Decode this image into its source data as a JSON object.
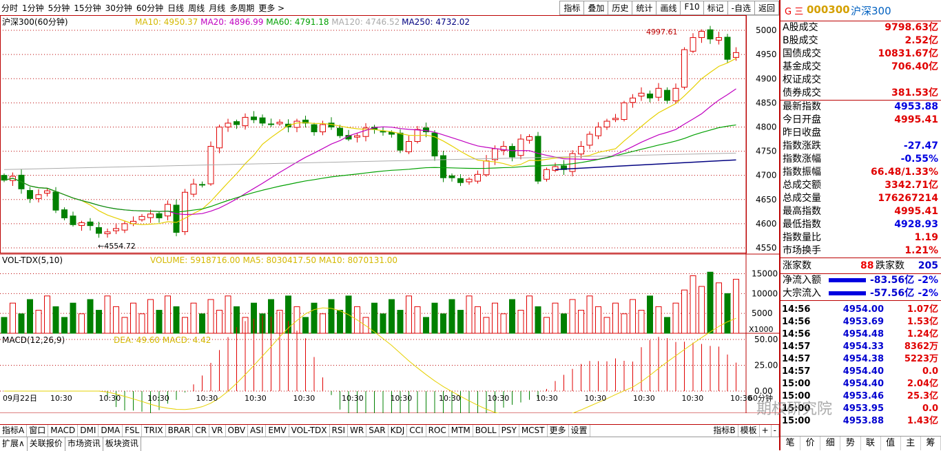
{
  "toolbar": {
    "periods": [
      "分时",
      "1分钟",
      "5分钟",
      "15分钟",
      "30分钟",
      "60分钟",
      "日线",
      "周线",
      "月线",
      "多周期",
      "更多 >"
    ],
    "tools": [
      "指标",
      "叠加",
      "历史",
      "统计",
      "画线",
      "F10",
      "标记",
      "-自选",
      "返回"
    ]
  },
  "main_chart": {
    "title": "沪深300(60分钟)",
    "ma_labels": [
      {
        "text": "MA10: 4950.37",
        "color": "#d4b800"
      },
      {
        "text": "MA20: 4896.99",
        "color": "#c000c0"
      },
      {
        "text": "MA60: 4791.18",
        "color": "#00a000"
      },
      {
        "text": "MA120: 4746.52",
        "color": "#aaaaaa"
      },
      {
        "text": "MA250: 4732.02",
        "color": "#000080"
      }
    ],
    "high_label": "4997.61",
    "low_label": "4554.72",
    "y_ticks": [
      "5000",
      "4950",
      "4900",
      "4850",
      "4800",
      "4750",
      "4700",
      "4650",
      "4600",
      "4550"
    ]
  },
  "volume_chart": {
    "title": "VOL-TDX(5,10)",
    "labels": "VOLUME: 5918716.00  MA5: 8030417.50  MA10: 8070131.00",
    "y_ticks": [
      "15000",
      "10000",
      "5000"
    ],
    "unit": "X1000"
  },
  "macd_chart": {
    "title": "MACD(12,26,9)",
    "labels": "DEA: 49.60  MACD: 4.42",
    "y_ticks": [
      "50.00",
      "25.00",
      "0.00"
    ]
  },
  "x_axis": {
    "first": "09月22日",
    "tick": "10:30",
    "period_label": "60分钟"
  },
  "indicator_tabs": [
    "指标A",
    "窗口",
    "MACD",
    "DMI",
    "DMA",
    "FSL",
    "TRIX",
    "BRAR",
    "CR",
    "VR",
    "OBV",
    "ASI",
    "EMV",
    "VOL-TDX",
    "RSI",
    "WR",
    "SAR",
    "KDJ",
    "CCI",
    "ROC",
    "MTM",
    "BOLL",
    "PSY",
    "MCST",
    "更多",
    "设置"
  ],
  "indicator_right": [
    "指标B",
    "模板",
    "+",
    "-"
  ],
  "bottom_tabs": [
    "扩展∧",
    "关联报价",
    "市场资讯",
    "板块资讯"
  ],
  "quote": {
    "flag": "G 三",
    "code": "000300",
    "name": "沪深300",
    "rows": [
      {
        "label": "A股成交",
        "value": "9798.63亿",
        "color": "red"
      },
      {
        "label": "B股成交",
        "value": "2.52亿",
        "color": "red"
      },
      {
        "label": "国债成交",
        "value": "10831.67亿",
        "color": "red"
      },
      {
        "label": "基金成交",
        "value": "706.40亿",
        "color": "red"
      },
      {
        "label": "权证成交",
        "value": "",
        "color": "red"
      },
      {
        "label": "债券成交",
        "value": "381.53亿",
        "color": "red"
      },
      {
        "label": "最新指数",
        "value": "4953.88",
        "color": "blue"
      },
      {
        "label": "今日开盘",
        "value": "4995.41",
        "color": "red"
      },
      {
        "label": "昨日收盘",
        "value": "",
        "color": "red"
      },
      {
        "label": "指数涨跌",
        "value": "-27.47",
        "color": "blue"
      },
      {
        "label": "指数涨幅",
        "value": "-0.55%",
        "color": "blue"
      },
      {
        "label": "指数振幅",
        "value": "66.48/1.33%",
        "color": "red"
      },
      {
        "label": "总成交额",
        "value": "3342.71亿",
        "color": "red"
      },
      {
        "label": "总成交量",
        "value": "176267214",
        "color": "red"
      },
      {
        "label": "最高指数",
        "value": "4995.41",
        "color": "red"
      },
      {
        "label": "最低指数",
        "value": "4928.93",
        "color": "blue"
      },
      {
        "label": "指数量比",
        "value": "1.19",
        "color": "red"
      },
      {
        "label": "市场换手",
        "value": "1.21%",
        "color": "red"
      }
    ],
    "updown": {
      "up_label": "涨家数",
      "up": "88",
      "down_label": "跌家数",
      "down": "205"
    },
    "flows": [
      {
        "label": "净流入额",
        "value": "-83.56亿",
        "pct": "-2%"
      },
      {
        "label": "大宗流入",
        "value": "-57.56亿",
        "pct": "-2%"
      }
    ],
    "ticks": [
      {
        "time": "14:56",
        "price": "4954.00",
        "vol": "1.07亿"
      },
      {
        "time": "14:56",
        "price": "4953.69",
        "vol": "1.53亿"
      },
      {
        "time": "14:56",
        "price": "4954.48",
        "vol": "1.24亿"
      },
      {
        "time": "14:57",
        "price": "4954.33",
        "vol": "8362万"
      },
      {
        "time": "14:57",
        "price": "4954.38",
        "vol": "5223万"
      },
      {
        "time": "14:57",
        "price": "4954.40",
        "vol": "0.0"
      },
      {
        "time": "15:00",
        "price": "4954.40",
        "vol": "2.04亿"
      },
      {
        "time": "15:00",
        "price": "4953.46",
        "vol": "25.3亿"
      },
      {
        "time": "15:00",
        "price": "4953.95",
        "vol": "0.0"
      },
      {
        "time": "15:00",
        "price": "4953.88",
        "vol": "1.43亿"
      }
    ],
    "tabs": [
      "笔",
      "价",
      "细",
      "势",
      "联",
      "值",
      "主",
      "筹"
    ]
  },
  "watermark": "期权研究院",
  "chart_data": {
    "type": "candlestick",
    "title": "沪深300(60分钟)",
    "ylim": [
      4540,
      5020
    ],
    "ma_series": [
      {
        "name": "MA10",
        "last": 4950.37
      },
      {
        "name": "MA20",
        "last": 4896.99
      },
      {
        "name": "MA60",
        "last": 4791.18
      },
      {
        "name": "MA120",
        "last": 4746.52
      },
      {
        "name": "MA250",
        "last": 4732.02
      }
    ],
    "close": [
      4690,
      4698,
      4672,
      4652,
      4660,
      4668,
      4628,
      4612,
      4598,
      4602,
      4596,
      4580,
      4583,
      4590,
      4600,
      4605,
      4615,
      4620,
      4612,
      4640,
      4582,
      4665,
      4682,
      4680,
      4760,
      4800,
      4808,
      4805,
      4820,
      4815,
      4808,
      4805,
      4810,
      4800,
      4812,
      4808,
      4790,
      4805,
      4800,
      4782,
      4775,
      4782,
      4798,
      4795,
      4790,
      4785,
      4752,
      4770,
      4795,
      4790,
      4740,
      4695,
      4695,
      4685,
      4692,
      4702,
      4730,
      4755,
      4760,
      4738,
      4775,
      4780,
      4688,
      4712,
      4718,
      4712,
      4745,
      4760,
      4785,
      4800,
      4812,
      4818,
      4850,
      4860,
      4870,
      4860,
      4880,
      4855,
      4880,
      4960,
      4985,
      4998,
      4982,
      4985,
      4940,
      4954
    ]
  }
}
